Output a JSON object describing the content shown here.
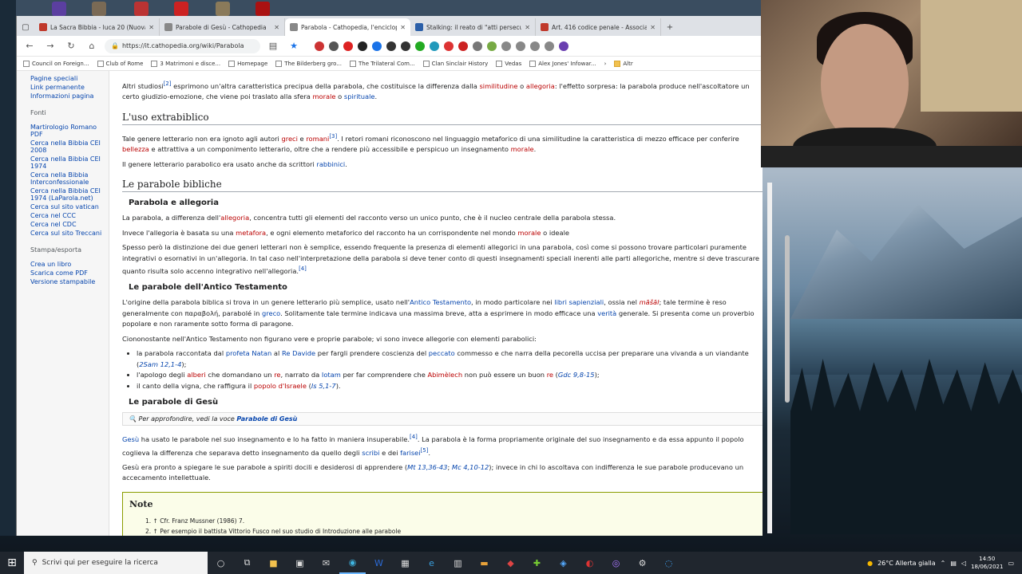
{
  "tabs": [
    {
      "title": "La Sacra Bibbia - luca 20 (Nuova",
      "color": "#c0392b"
    },
    {
      "title": "Parabole di Gesù - Cathopedia",
      "color": "#888888"
    },
    {
      "title": "Parabola - Cathopedia, l'enciclop",
      "color": "#888888",
      "active": true
    },
    {
      "title": "Stalking: il reato di \"atti persecut",
      "color": "#2b5fa8"
    },
    {
      "title": "Art. 416 codice penale - Associa",
      "color": "#c0392b"
    }
  ],
  "url": "https://it.cathopedia.org/wiki/Parabola",
  "bookmarks": [
    "Council on Foreign...",
    "Club of Rome",
    "3 Matrimoni e disce...",
    "Homepage",
    "The Bilderberg gro...",
    "The Trilateral Com...",
    "Clan Sinclair History",
    "Vedas",
    "Alex Jones' Infowar...",
    "Altr"
  ],
  "sidebar": {
    "top": [
      "Pagine speciali",
      "Link permanente",
      "Informazioni pagina"
    ],
    "fonti_title": "Fonti",
    "fonti": [
      "Martirologio Romano PDF",
      "Cerca nella Bibbia CEI 2008",
      "Cerca nella Bibbia CEI 1974",
      "Cerca nella Bibbia Interconfessionale",
      "Cerca nella Bibbia CEI 1974 (LaParola.net)",
      "Cerca sul sito vatican",
      "Cerca nel CCC",
      "Cerca nel CDC",
      "Cerca sul sito Treccani"
    ],
    "stampa_title": "Stampa/esporta",
    "stampa": [
      "Crea un libro",
      "Scarica come PDF",
      "Versione stampabile"
    ]
  },
  "content": {
    "intro_a": "Altri studiosi",
    "intro_sup": "[2]",
    "intro_b": " esprimono un'altra caratteristica precipua della parabola, che costituisce la differenza dalla ",
    "intro_l1": "similitudine",
    "intro_c": " o ",
    "intro_l2": "allegoria",
    "intro_d": ": l'effetto sorpresa: la parabola produce nell'ascoltatore un certo giudizio-emozione, che viene poi traslato alla sfera ",
    "intro_l3": "morale",
    "intro_e": " o ",
    "intro_l4": "spirituale",
    "intro_f": ".",
    "h_extra": "L'uso extrabiblico",
    "extra1_a": "Tale genere letterario non era ignoto agli autori ",
    "extra1_l1": "greci",
    "extra1_b": " e ",
    "extra1_l2": "romani",
    "extra1_sup": "[3]",
    "extra1_c": ". I retori romani riconoscono nel linguaggio metaforico di una similitudine la caratteristica di mezzo efficace per conferire ",
    "extra1_l3": "bellezza",
    "extra1_d": " e attrattiva a un componimento letterario, oltre che a rendere più accessibile e perspicuo un insegnamento ",
    "extra1_l4": "morale",
    "extra1_e": ".",
    "extra2_a": "Il genere letterario parabolico era usato anche da scrittori ",
    "extra2_l": "rabbinici",
    "extra2_b": ".",
    "h_bib": "Le parabole bibliche",
    "h_alleg": "Parabola e allegoria",
    "alleg1_a": "La parabola, a differenza dell'",
    "alleg1_l": "allegoria",
    "alleg1_b": ", concentra tutti gli elementi del racconto verso un unico punto, che è il nucleo centrale della parabola stessa.",
    "alleg2_a": "Invece l'allegoria è basata su una ",
    "alleg2_l1": "metafora",
    "alleg2_b": ", e ogni elemento metaforico del racconto ha un corrispondente nel mondo ",
    "alleg2_l2": "morale",
    "alleg2_c": " o ideale",
    "alleg3": "Spesso però la distinzione dei due generi letterari non è semplice, essendo frequente la presenza di elementi allegorici in una parabola, così come si possono trovare particolari puramente integrativi o esornativi in un'allegoria. In tal caso nell'interpretazione della parabola si deve tener conto di questi insegnamenti speciali inerenti alle parti allegoriche, mentre si deve trascurare quanto risulta solo accenno integrativo nell'allegoria.",
    "alleg3_sup": "[4]",
    "h_at": "Le parabole dell'Antico Testamento",
    "at1_a": "L'origine della parabola biblica si trova in un genere letterario più semplice, usato nell'",
    "at1_l1": "Antico Testamento",
    "at1_b": ", in modo particolare nei ",
    "at1_l2": "libri sapienziali",
    "at1_c": ", ossia nel ",
    "at1_l3": "māšāl",
    "at1_d": "; tale termine è reso generalmente con παραβολή, parabolé in ",
    "at1_l4": "greco",
    "at1_e": ". Solitamente tale termine indicava una massima breve, atta a esprimere in modo efficace una ",
    "at1_l5": "verità",
    "at1_f": " generale. Si presenta come un proverbio popolare e non raramente sotto forma di paragone.",
    "at2": "Ciononostante nell'Antico Testamento non figurano vere e proprie parabole; vi sono invece allegorie con elementi parabolici:",
    "li1_a": "la parabola raccontata dal ",
    "li1_l1": "profeta Natan",
    "li1_b": " al ",
    "li1_l2": "Re Davide",
    "li1_c": " per fargli prendere coscienza del ",
    "li1_l3": "peccato",
    "li1_d": " commesso e che narra della pecorella uccisa per preparare una vivanda a un viandante (",
    "li1_l4": "2Sam 12,1-4",
    "li1_e": ");",
    "li2_a": "l'apologo degli ",
    "li2_l1": "alberi",
    "li2_b": " che domandano un ",
    "li2_l2": "re",
    "li2_c": ", narrato da ",
    "li2_l3": "Iotam",
    "li2_d": " per far comprendere che ",
    "li2_l4": "Abimèlech",
    "li2_e": " non può essere un buon ",
    "li2_l5": "re",
    "li2_f": " (",
    "li2_l6": "Gdc 9,8-15",
    "li2_g": ");",
    "li3_a": "il canto della vigna, che raffigura il ",
    "li3_l1": "popolo d'Israele",
    "li3_b": " (",
    "li3_l2": "Is 5,1-7",
    "li3_c": ").",
    "h_gesu": "Le parabole di Gesù",
    "see_a": "Per approfondire, vedi la voce ",
    "see_l": "Parabole di Gesù",
    "g1_l1": "Gesù",
    "g1_a": " ha usato le parabole nel suo insegnamento e lo ha fatto in maniera insuperabile.",
    "g1_sup": "[4]",
    "g1_b": ". La parabola è la forma propriamente originale del suo insegnamento e da essa appunto il popolo coglieva la differenza che separava detto insegnamento da quello degli ",
    "g1_l2": "scribi",
    "g1_c": " e dei ",
    "g1_l3": "farisei",
    "g1_sup2": "[5]",
    "g1_d": ".",
    "g2_a": "Gesù era pronto a spiegare le sue parabole a spiriti docili e desiderosi di apprendere (",
    "g2_l1": "Mt 13,36-43",
    "g2_b": "; ",
    "g2_l2": "Mc 4,10-12",
    "g2_c": "); invece in chi lo ascoltava con indifferenza le sue parabole producevano un accecamento intellettuale.",
    "note_title": "Note",
    "note1": "1. ↑ Cfr. Franz Mussner (1986) 7.",
    "note2": "2. ↑ Per esempio il battista Vittorio Fusco nel suo studio di Introduzione alle parabole"
  },
  "taskbar": {
    "search_placeholder": "Scrivi qui per eseguire la ricerca",
    "weather": "26°C  Allerta gialla",
    "time": "14:50",
    "date": "18/06/2021"
  }
}
